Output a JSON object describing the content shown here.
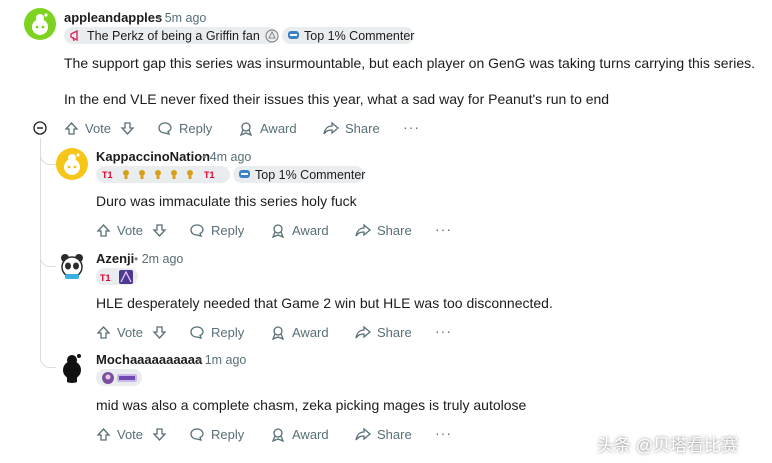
{
  "comments": [
    {
      "username": "appleandapples",
      "time": "5m ago",
      "flair_text": "The Perkz of being a Griffin fan",
      "badge": "Top 1% Commenter",
      "lines": [
        "The support gap this series was insurmountable, but each player on GenG was taking turns carrying this series.",
        "In the end VLE never fixed their issues this year, what a sad way for Peanut's run to end"
      ]
    },
    {
      "username": "KappaccinoNation",
      "time": "4m ago",
      "badge": "Top 1% Commenter",
      "lines": [
        "Duro was immaculate this series holy fuck"
      ]
    },
    {
      "username": "Azenji",
      "time": "2m ago",
      "lines": [
        "HLE desperately needed that Game 2 win but HLE was too disconnected."
      ]
    },
    {
      "username": "Mochaaaaaaaaaa",
      "time": "1m ago",
      "lines": [
        "mid was also a complete chasm, zeka picking mages is truly autolose"
      ]
    }
  ],
  "actions": {
    "vote": "Vote",
    "reply": "Reply",
    "award": "Award",
    "share": "Share",
    "more": "···"
  },
  "watermark": "头条 @贝塔看比赛",
  "colors": {
    "text": "#1c1c1c",
    "meta": "#576f76",
    "flair_bg": "#eaedef",
    "thread_line": "#d9dde0",
    "t1_red": "#e2012d"
  }
}
